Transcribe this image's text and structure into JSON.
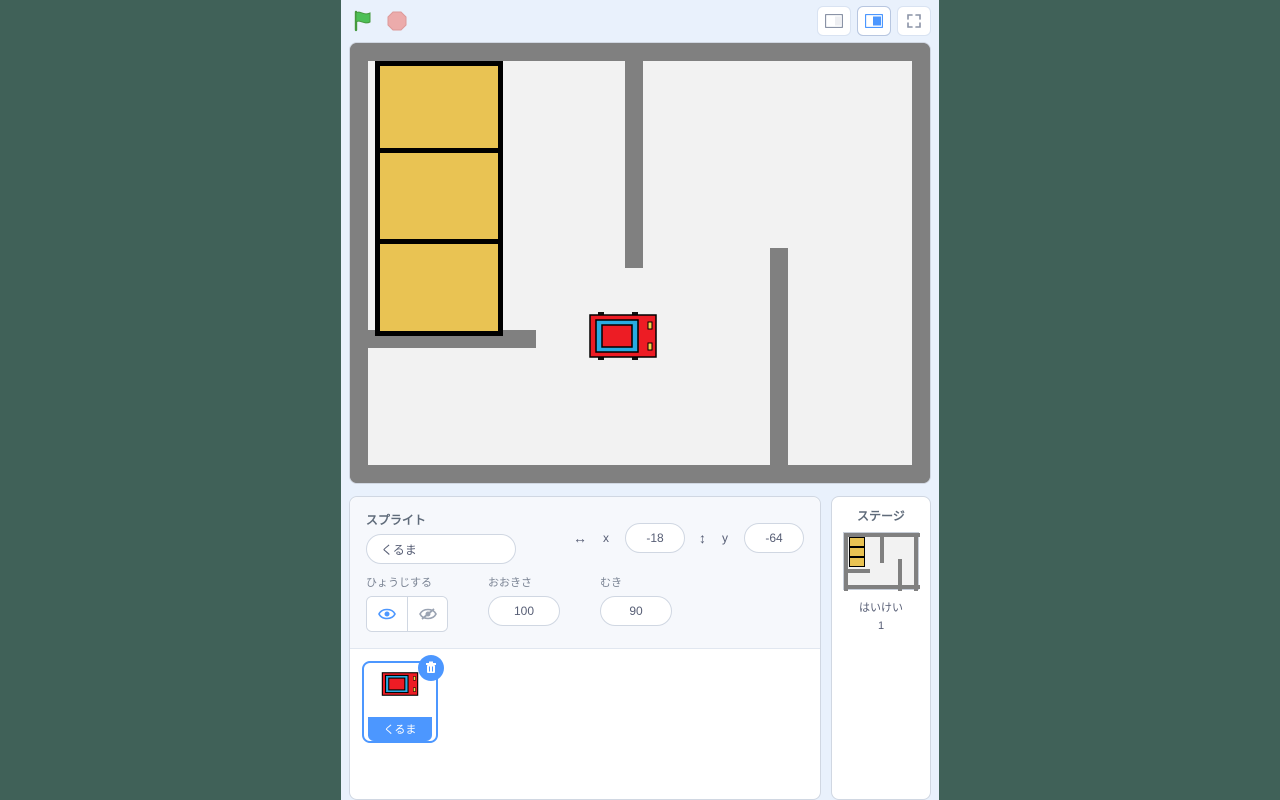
{
  "header": {
    "flag_icon": "green-flag-icon",
    "stop_icon": "stop-icon",
    "view_small_icon": "small-stage-icon",
    "view_large_icon": "large-stage-icon",
    "fullscreen_icon": "fullscreen-icon"
  },
  "sprite_info": {
    "label": "スプライト",
    "name": "くるま",
    "x_label": "x",
    "x": "-18",
    "y_label": "y",
    "y": "-64",
    "show_label": "ひょうじする",
    "size_label": "おおきさ",
    "size": "100",
    "direction_label": "むき",
    "direction": "90"
  },
  "sprite_list": [
    {
      "name": "くるま"
    }
  ],
  "stage_panel": {
    "label": "ステージ",
    "backdrop_label": "はいけい",
    "backdrop_count": "1"
  },
  "icons": {
    "eye": "eye-icon",
    "eye_off": "eye-off-icon",
    "hdir": "horizontal-arrows-icon",
    "vdir": "vertical-arrows-icon",
    "trash": "trash-icon"
  },
  "colors": {
    "accent": "#4c97ff",
    "wall": "#808080",
    "parking": "#e9c353",
    "car_body": "#ed1c24",
    "car_window": "#29abe2"
  }
}
